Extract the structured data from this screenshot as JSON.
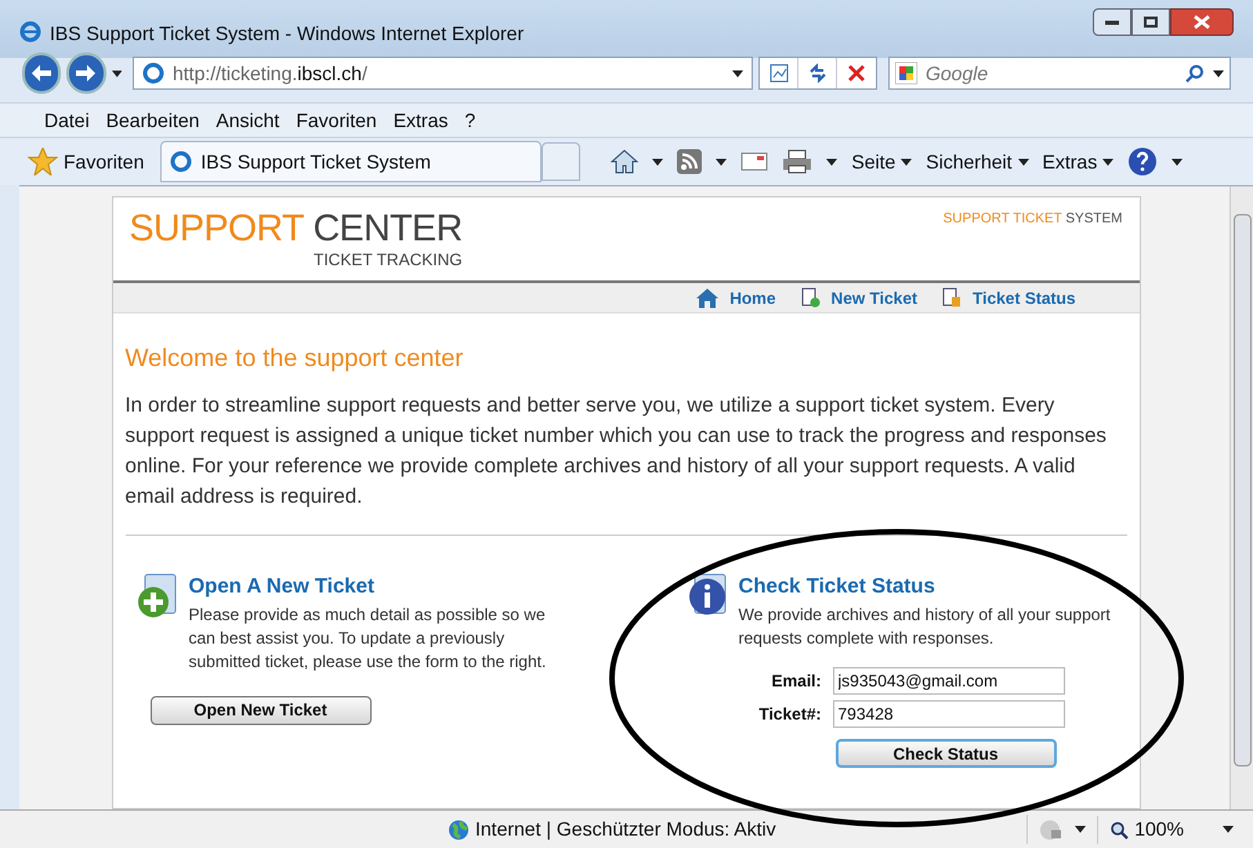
{
  "window": {
    "title": "IBS Support Ticket System - Windows Internet Explorer"
  },
  "address_bar": {
    "url_prefix": "http://ticketing.",
    "url_domain": "ibscl.ch",
    "url_suffix": "/"
  },
  "search": {
    "placeholder": "Google"
  },
  "menu": [
    "Datei",
    "Bearbeiten",
    "Ansicht",
    "Favoriten",
    "Extras",
    "?"
  ],
  "favorites_bar": {
    "favorites": "Favoriten",
    "tab": "IBS Support Ticket System",
    "commands": [
      "Seite",
      "Sicherheit",
      "Extras"
    ]
  },
  "page": {
    "logo_main_a": "SUPPORT",
    "logo_main_b": "CENTER",
    "logo_sub": "TICKET TRACKING",
    "tagline_a": "SUPPORT TICKET",
    "tagline_b": "SYSTEM",
    "nav": [
      {
        "label": "Home",
        "kind": "home"
      },
      {
        "label": "New Ticket",
        "kind": "new"
      },
      {
        "label": "Ticket Status",
        "kind": "status"
      }
    ],
    "heading": "Welcome to the support center",
    "intro": "In order to streamline support requests and better serve you, we utilize a support ticket system. Every support request is assigned a unique ticket number which you can use to track the progress and responses online. For your reference we provide complete archives and history of all your support requests. A valid email address is required.",
    "new_ticket": {
      "title": "Open A New Ticket",
      "text": "Please provide as much detail as possible so we can best assist you. To update a previously submitted ticket, please use the form to the right.",
      "button": "Open New Ticket"
    },
    "check_status": {
      "title": "Check Ticket Status",
      "text": "We provide archives and history of all your support requests complete with responses.",
      "email_label": "Email:",
      "email_value": "js935043@gmail.com",
      "ticket_label": "Ticket#:",
      "ticket_value": "793428",
      "button": "Check Status"
    }
  },
  "status_bar": {
    "zone": "Internet | Geschützter Modus: Aktiv",
    "zoom": "100%"
  }
}
